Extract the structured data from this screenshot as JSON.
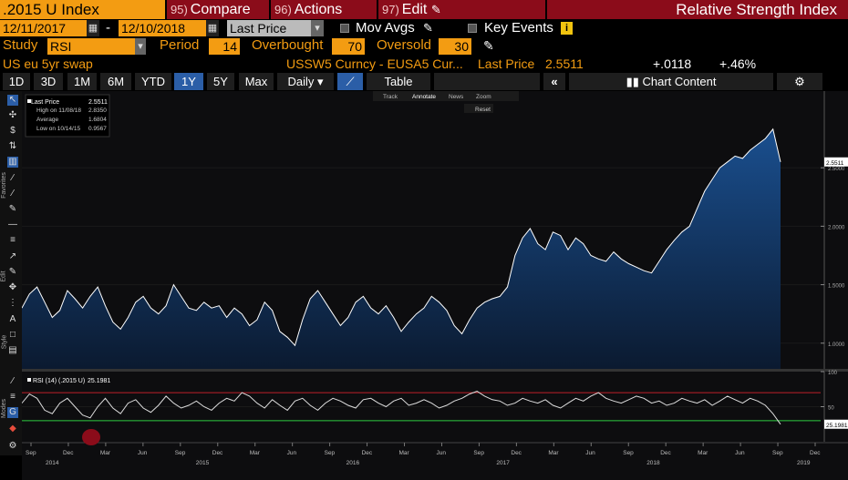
{
  "header": {
    "ticker": ".2015 U Index",
    "compare_num": "95)",
    "compare": "Compare",
    "actions_num": "96)",
    "actions": "Actions",
    "edit_num": "97)",
    "edit": "Edit",
    "edit_icon": "pencil-icon",
    "title": "Relative Strength Index"
  },
  "controls": {
    "start_date": "12/11/2017",
    "dash": "-",
    "end_date": "12/10/2018",
    "price_field": "Last Price",
    "mov_avgs": "Mov Avgs",
    "key_events": "Key Events",
    "study_label": "Study",
    "study_value": "RSI",
    "period_label": "Period",
    "period_value": "14",
    "overbought_label": "Overbought",
    "overbought_value": "70",
    "oversold_label": "Oversold",
    "oversold_value": "30"
  },
  "security": {
    "name": "US eu 5yr swap",
    "desc": "USSW5 Curncy - EUSA5 Cur...",
    "last_price_label": "Last Price",
    "last_price": "2.5511",
    "change": "+.0118",
    "change_pct": "+.46%"
  },
  "toolbar": {
    "ranges": [
      "1D",
      "3D",
      "1M",
      "6M",
      "YTD",
      "1Y",
      "5Y",
      "Max"
    ],
    "selected": "1Y",
    "freq": "Daily",
    "table": "Table",
    "chart_content": "Chart Content"
  },
  "chart_tools": {
    "track": "Track",
    "annotate": "Annotate",
    "news": "News",
    "zoom": "Zoom",
    "reset": "Reset"
  },
  "side_labels": {
    "favorites": "Favorites",
    "edit": "Edit",
    "style": "Style",
    "modes": "Modes"
  },
  "colors": {
    "accent": "#f39c12",
    "menu": "#8b0c1a",
    "area": "#0b2a52",
    "line": "#ffffff",
    "overbought": "#c0202a",
    "oversold": "#2ecc40"
  },
  "chart_data": [
    {
      "type": "area",
      "title": "",
      "legend": [
        {
          "label": "Last Price",
          "value": "2.5511"
        },
        {
          "label": "High on 11/08/18",
          "value": "2.8350"
        },
        {
          "label": "Average",
          "value": "1.6804"
        },
        {
          "label": "Low on 10/14/15",
          "value": "0.9567"
        }
      ],
      "ylim": [
        0.78,
        3.0
      ],
      "yticks": [
        1.0,
        1.5,
        2.0,
        2.5
      ],
      "ytick_labels": [
        "1.0000",
        "1.5000",
        "2.0000",
        "2.5000"
      ],
      "last_label": "2.5511",
      "x_month_ticks": [
        "Sep",
        "Dec",
        "Mar",
        "Jun",
        "Sep",
        "Dec",
        "Mar",
        "Jun",
        "Sep",
        "Dec",
        "Mar",
        "Jun",
        "Sep",
        "Dec",
        "Mar",
        "Jun",
        "Sep",
        "Dec",
        "Mar",
        "Jun",
        "Sep",
        "Dec"
      ],
      "x_year_ticks": [
        "2014",
        "2015",
        "2016",
        "2017",
        "2018",
        "2019"
      ],
      "x": [
        0,
        1,
        2,
        3,
        4,
        5,
        6,
        7,
        8,
        9,
        10,
        11,
        12,
        13,
        14,
        15,
        16,
        17,
        18,
        19,
        20,
        21,
        22,
        23,
        24,
        25,
        26,
        27,
        28,
        29,
        30,
        31,
        32,
        33,
        34,
        35,
        36,
        37,
        38,
        39,
        40,
        41,
        42,
        43,
        44,
        45,
        46,
        47,
        48,
        49,
        50,
        51,
        52,
        53,
        54,
        55,
        56,
        57,
        58,
        59,
        60,
        61,
        62,
        63,
        64,
        65,
        66,
        67,
        68,
        69,
        70,
        71,
        72,
        73,
        74,
        75,
        76,
        77,
        78,
        79,
        80,
        81,
        82,
        83,
        84,
        85,
        86,
        87,
        88,
        89,
        90,
        91,
        92,
        93,
        94,
        95,
        96,
        97,
        98,
        99,
        100
      ],
      "values": [
        1.3,
        1.42,
        1.48,
        1.35,
        1.22,
        1.28,
        1.45,
        1.38,
        1.3,
        1.4,
        1.48,
        1.32,
        1.18,
        1.12,
        1.22,
        1.35,
        1.4,
        1.3,
        1.25,
        1.32,
        1.5,
        1.4,
        1.3,
        1.28,
        1.35,
        1.3,
        1.32,
        1.22,
        1.3,
        1.25,
        1.15,
        1.2,
        1.35,
        1.28,
        1.1,
        1.05,
        0.98,
        1.2,
        1.38,
        1.45,
        1.35,
        1.25,
        1.15,
        1.22,
        1.35,
        1.4,
        1.3,
        1.25,
        1.32,
        1.22,
        1.1,
        1.18,
        1.25,
        1.3,
        1.4,
        1.35,
        1.28,
        1.15,
        1.08,
        1.2,
        1.3,
        1.35,
        1.38,
        1.4,
        1.48,
        1.75,
        1.9,
        1.98,
        1.85,
        1.8,
        1.95,
        1.92,
        1.8,
        1.9,
        1.85,
        1.75,
        1.72,
        1.7,
        1.78,
        1.72,
        1.68,
        1.65,
        1.62,
        1.6,
        1.7,
        1.8,
        1.88,
        1.95,
        2.0,
        2.15,
        2.3,
        2.4,
        2.5,
        2.55,
        2.6,
        2.58,
        2.65,
        2.7,
        2.75,
        2.83,
        2.55
      ]
    },
    {
      "type": "line",
      "title": "",
      "legend": [
        {
          "label": "RSI (14) (.2015 U)",
          "value": "25.1981"
        }
      ],
      "ylim": [
        0,
        100
      ],
      "yticks": [
        50,
        100
      ],
      "ytick_labels": [
        "50",
        "100"
      ],
      "overbought": 70,
      "oversold": 30,
      "last_label": "25.1981",
      "values": [
        55,
        68,
        62,
        45,
        40,
        55,
        62,
        50,
        38,
        34,
        50,
        62,
        48,
        40,
        55,
        60,
        48,
        42,
        52,
        65,
        55,
        48,
        52,
        58,
        50,
        45,
        55,
        62,
        58,
        70,
        65,
        55,
        48,
        60,
        52,
        45,
        58,
        62,
        52,
        45,
        55,
        62,
        58,
        52,
        48,
        60,
        62,
        55,
        50,
        58,
        62,
        52,
        55,
        60,
        55,
        48,
        52,
        58,
        62,
        68,
        72,
        65,
        60,
        58,
        52,
        55,
        62,
        58,
        55,
        60,
        52,
        48,
        55,
        62,
        58,
        65,
        70,
        62,
        58,
        55,
        60,
        65,
        62,
        55,
        58,
        52,
        55,
        62,
        58,
        55,
        60,
        52,
        58,
        65,
        60,
        55,
        62,
        58,
        52,
        40,
        25
      ]
    }
  ]
}
